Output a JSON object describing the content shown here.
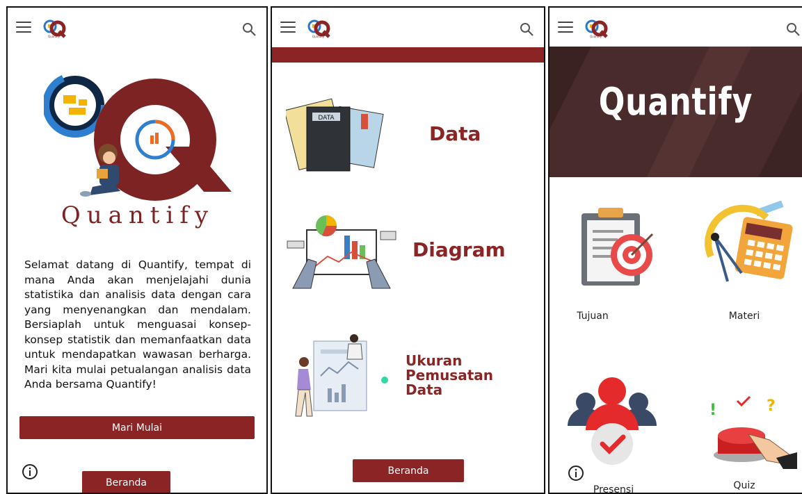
{
  "app": {
    "logo_text": "Quantify",
    "logo_tag": "Quantify",
    "accent_color": "#8b2424"
  },
  "screen1": {
    "hero_word": "Quantify",
    "welcome": "Selamat datang di Quantify, tempat di mana Anda akan menjelajahi dunia statistika dan analisis data dengan cara yang menyenangkan dan mendalam. Bersiaplah untuk menguasai konsep-konsep statistik dan memanfaatkan data untuk mendapatkan wawasan berharga. Mari kita mulai petualangan analisis data Anda bersama Quantify!",
    "start_label": "Mari Mulai",
    "home_label": "Beranda"
  },
  "screen2": {
    "items": [
      {
        "label": "Data",
        "illustration_text": "DATA"
      },
      {
        "label": "Diagram"
      },
      {
        "label": "Ukuran Pemusatan Data"
      }
    ],
    "home_label": "Beranda"
  },
  "screen3": {
    "banner_title": "Quantify",
    "tiles": [
      {
        "label": "Tujuan"
      },
      {
        "label": "Materi"
      },
      {
        "label": "Presensi"
      },
      {
        "label": "Quiz"
      }
    ]
  }
}
